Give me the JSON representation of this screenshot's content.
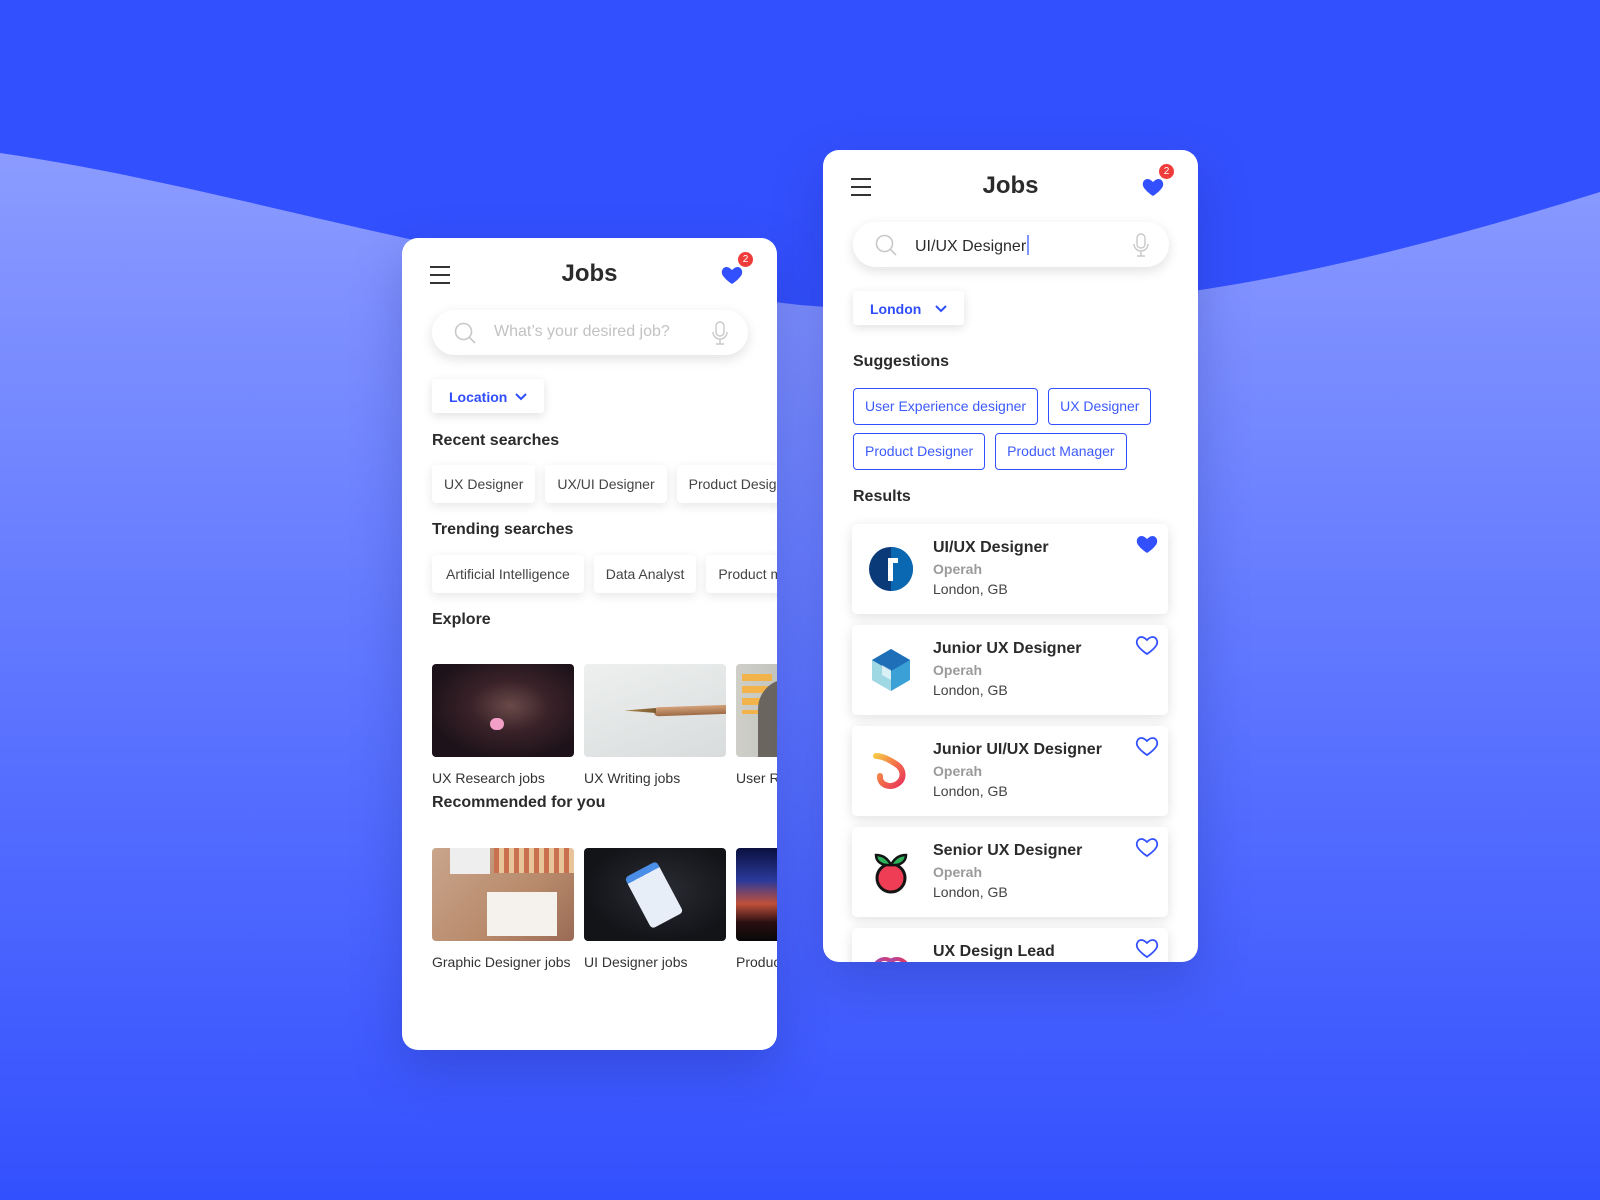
{
  "colors": {
    "background": "#3350fe",
    "accent": "#3350fe",
    "badge": "#f03b3b"
  },
  "left_screen": {
    "title": "Jobs",
    "menu_icon": "hamburger-icon",
    "favorites": {
      "icon": "heart-icon",
      "count": "2"
    },
    "search": {
      "placeholder": "What’s your desired job?",
      "value": "",
      "icon": "search-icon",
      "mic_icon": "microphone-icon"
    },
    "location_button": {
      "label": "Location",
      "icon": "chevron-down-icon"
    },
    "recent": {
      "title": "Recent searches",
      "items": [
        "UX Designer",
        "UX/UI Designer",
        "Product Designer"
      ]
    },
    "trending": {
      "title": "Trending searches",
      "items": [
        "Artificial Intelligence",
        "Data Analyst",
        "Product manager"
      ]
    },
    "explore": {
      "title": "Explore",
      "items": [
        {
          "label": "UX Research jobs"
        },
        {
          "label": "UX Writing jobs"
        },
        {
          "label": "User Research jobs"
        }
      ]
    },
    "recommended": {
      "title": "Recommended for you",
      "items": [
        {
          "label": "Graphic Designer jobs"
        },
        {
          "label": "UI Designer jobs"
        },
        {
          "label": "Product Designer jobs"
        }
      ]
    }
  },
  "right_screen": {
    "title": "Jobs",
    "menu_icon": "hamburger-icon",
    "favorites": {
      "icon": "heart-icon",
      "count": "2"
    },
    "search": {
      "value": "UI/UX Designer",
      "icon": "search-icon",
      "mic_icon": "microphone-icon"
    },
    "location_button": {
      "label": "London",
      "icon": "chevron-down-icon"
    },
    "suggestions": {
      "title": "Suggestions",
      "items": [
        "User Experience designer",
        "UX Designer",
        "Product Designer",
        "Product Manager"
      ]
    },
    "results": {
      "title": "Results",
      "items": [
        {
          "title": "UI/UX Designer",
          "company": "Operah",
          "location": "London, GB",
          "saved": true
        },
        {
          "title": "Junior UX Designer",
          "company": "Operah",
          "location": "London, GB",
          "saved": false
        },
        {
          "title": "Junior UI/UX Designer",
          "company": "Operah",
          "location": "London, GB",
          "saved": false
        },
        {
          "title": "Senior UX Designer",
          "company": "Operah",
          "location": "London, GB",
          "saved": false
        },
        {
          "title": "UX Design Lead",
          "company": "",
          "location": "",
          "saved": false
        }
      ]
    }
  }
}
